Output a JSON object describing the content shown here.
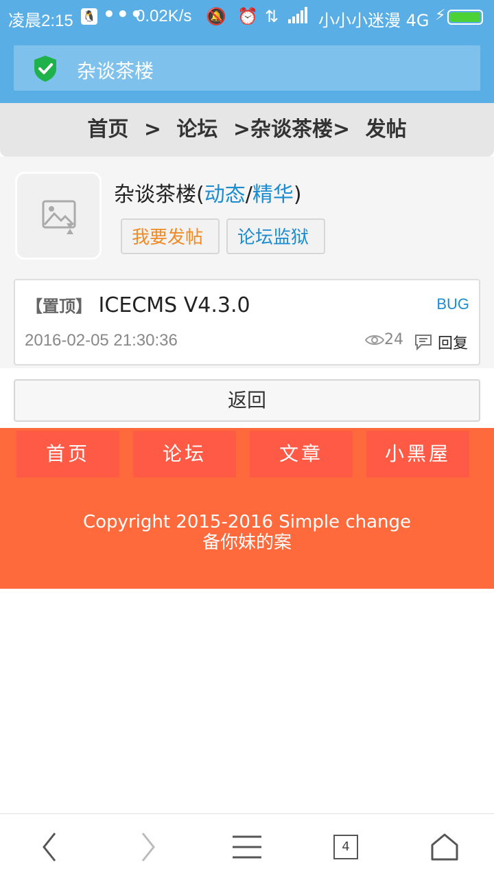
{
  "status_bar": {
    "time": "凌晨2:15",
    "qq_icon": "qq-icon",
    "dots": "•••",
    "speed": "0.02K/s",
    "carrier": "小小小迷漫 4G"
  },
  "header": {
    "title": "杂谈茶楼"
  },
  "breadcrumb": {
    "home": "首页",
    "sep1": ">",
    "forum": "论坛",
    "board": ">杂谈茶楼>",
    "action": "发帖"
  },
  "forum": {
    "name": "杂谈茶楼",
    "paren_open": "(",
    "activity": "动态",
    "slash": "/",
    "featured": "精华",
    "paren_close": ")",
    "post_button": "我要发帖",
    "jail_button": "论坛监狱"
  },
  "post": {
    "pinned": "【置顶】",
    "title": "ICECMS V4.3.0",
    "tag": "BUG",
    "date": "2016-02-05 21:30:36",
    "views": "24",
    "reply_label": "回复"
  },
  "back_button": "返回",
  "footer": {
    "nav": [
      "首页",
      "论坛",
      "文章",
      "小黑屋"
    ],
    "copyright": "Copyright 2015-2016 Simple change",
    "icp": "备你妹的案"
  },
  "browser": {
    "tabs_count": "4"
  },
  "colors": {
    "header_blue": "#5aaee6",
    "link_blue": "#1b8ccf",
    "footer_orange": "#ff6a3c",
    "post_button_orange": "#f08a24"
  }
}
